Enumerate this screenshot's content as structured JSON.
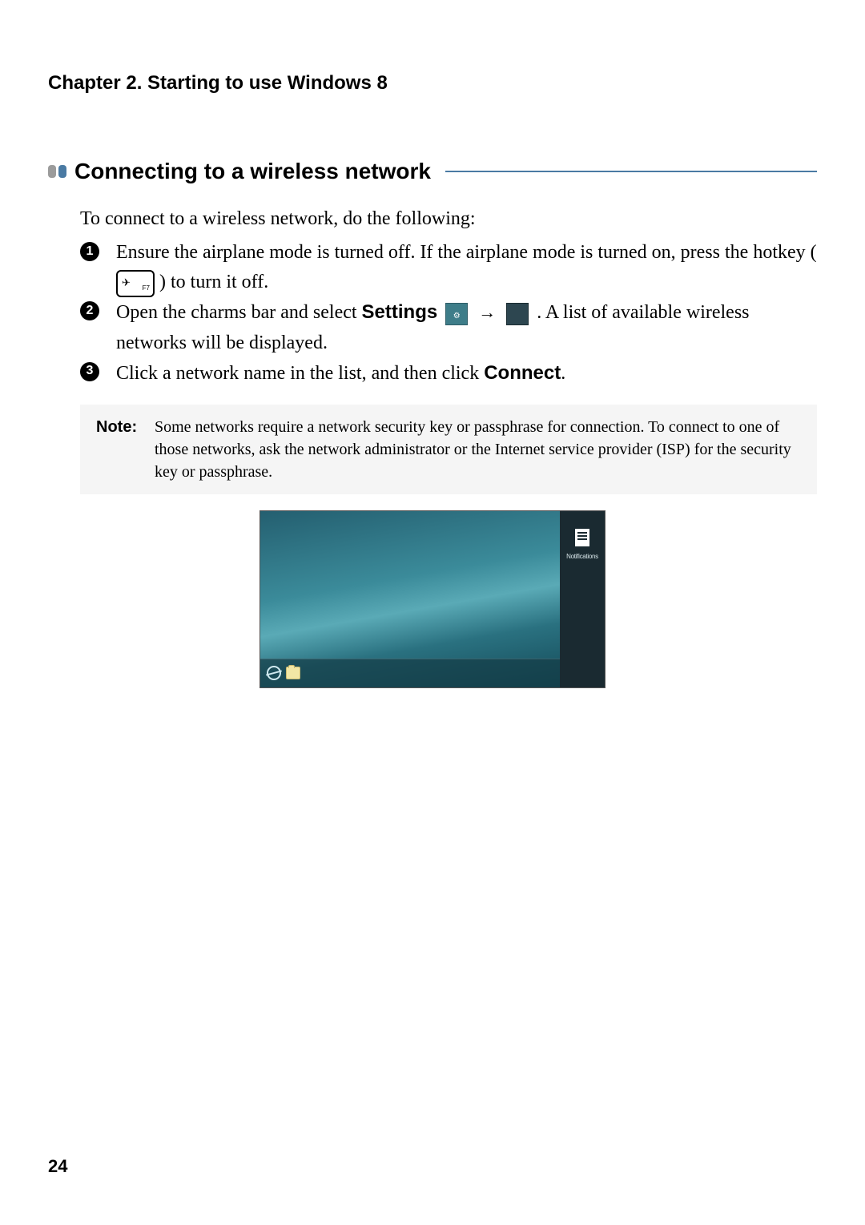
{
  "chapter": "Chapter 2. Starting to use Windows 8",
  "section_title": "Connecting to a wireless network",
  "intro": "To connect to a wireless network, do the following:",
  "steps": {
    "s1a": "Ensure the airplane mode is turned off. If the airplane mode is turned on, press the hotkey (",
    "s1b": ") to turn it off.",
    "hotkey_fn": "F7",
    "s2a": "Open the charms bar and select ",
    "s2_settings": "Settings",
    "arrow": "→",
    "s2b": ". A list of available wireless networks will be displayed.",
    "s3a": "Click a network name in the list, and then click ",
    "s3_connect": "Connect",
    "s3b": "."
  },
  "note_label": "Note:",
  "note_text": "Some networks require a network security key or passphrase for connection. To connect to one of those networks, ask the network administrator or the Internet service provider (ISP) for the security key or passphrase.",
  "screenshot": {
    "sidebar_label": "Notifications"
  },
  "page_number": "24"
}
